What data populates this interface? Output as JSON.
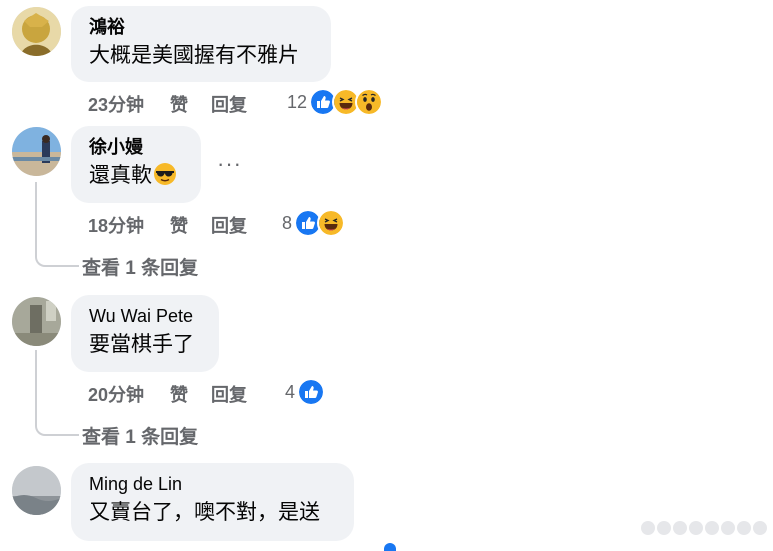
{
  "comments": [
    {
      "author": "鴻裕",
      "text": "大概是美國握有不雅片",
      "time": "23分钟",
      "like_label": "赞",
      "reply_label": "回复",
      "reaction_count": "12",
      "reactions": [
        "like",
        "haha",
        "wow"
      ]
    },
    {
      "author": "徐小嫚",
      "text": "還真軟",
      "text_emoji": "sunglasses-emoji",
      "time": "18分钟",
      "like_label": "赞",
      "reply_label": "回复",
      "reaction_count": "8",
      "reactions": [
        "like",
        "haha"
      ],
      "more_label": "···",
      "view_replies": "查看 1 条回复"
    },
    {
      "author": "Wu Wai Pete",
      "text": "要當棋手了",
      "time": "20分钟",
      "like_label": "赞",
      "reply_label": "回复",
      "reaction_count": "4",
      "reactions": [
        "like"
      ],
      "view_replies": "查看 1 条回复"
    },
    {
      "author": "Ming de Lin",
      "text": "又賣台了，噢不對，是送"
    }
  ],
  "colors": {
    "bubble": "#f0f2f5",
    "meta_text": "#65676b",
    "like_blue": "#1877f2",
    "haha_yellow": "#f7b928"
  }
}
